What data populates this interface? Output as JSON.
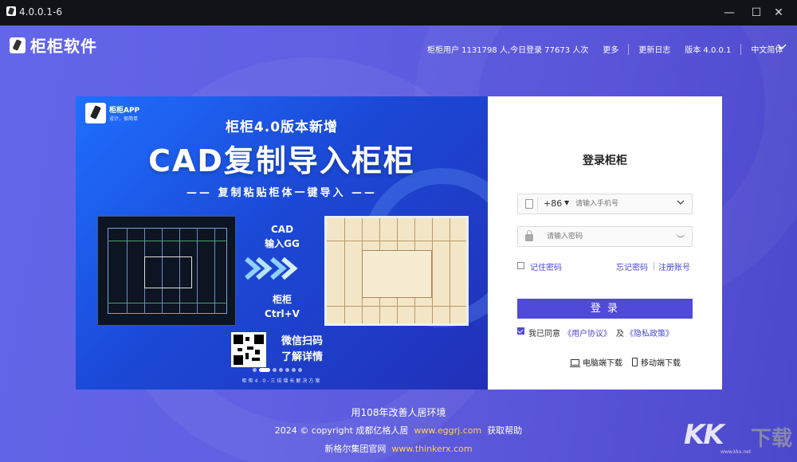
{
  "window": {
    "version": "4.0.0.1-6",
    "minimize": "—",
    "maximize": "☐",
    "close": "✕"
  },
  "header": {
    "logo_text": "柜柜软件",
    "stats": "柜柜用户 1131798 人,今日登录 77673 人次",
    "more": "更多",
    "changelog": "更新日志",
    "version": "版本 4.0.0.1",
    "language": "中文简体",
    "lang_icon": "chevron-down-icon"
  },
  "banner": {
    "app_name": "柜柜APP",
    "app_slogan": "设计，很简单",
    "headline": "柜柜4.0版本新增",
    "main_title": "CAD复制导入柜柜",
    "subtitle": "—— 复制粘贴柜体一键导入 ——",
    "step1_line1": "CAD",
    "step1_line2": "输入GG",
    "step2_line1": "柜柜",
    "step2_line2": "Ctrl+V",
    "scan_line1": "微信扫码",
    "scan_line2": "了解详情",
    "footer": "柜柜4.0-三倍增长解决方案",
    "slides": 7,
    "active_slide": 2
  },
  "login": {
    "title": "登录柜柜",
    "country_code": "+86",
    "phone_placeholder": "请输入手机号",
    "password_placeholder": "请输入密码",
    "remember": "记住密码",
    "forgot": "忘记密码",
    "register": "注册账号",
    "submit": "登 录",
    "agree_prefix": "我已同意",
    "user_agreement": "《用户协议》",
    "and": "及",
    "privacy_policy": "《隐私政策》",
    "pc_download": "电脑端下载",
    "mobile_download": "移动端下载",
    "agree_checked": true,
    "remember_checked": false
  },
  "footer": {
    "slogan": "用108年改善人居环境",
    "copyright": "2024 © copyright 成都亿格人居",
    "site1": "www.eggrj.com",
    "help": "获取帮助",
    "group": "新格尔集团官网",
    "site2": "www.thinkerx.com"
  },
  "watermark": {
    "kk": "KK",
    "xz": "下载",
    "domain": "www.kkx.net"
  },
  "colors": {
    "accent": "#4f4ad8",
    "background": "#5b60e0",
    "link_yellow": "#ffd24a"
  }
}
